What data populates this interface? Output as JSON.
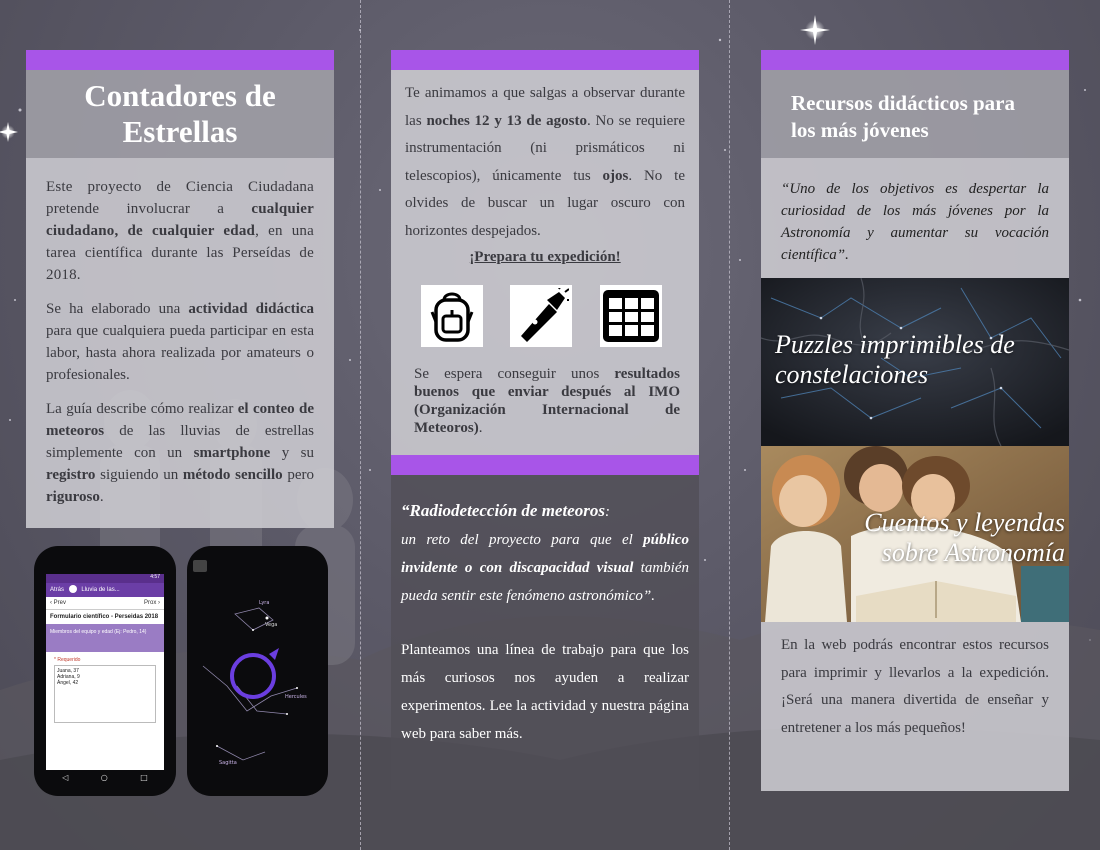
{
  "left": {
    "title": "Contadores de Estrellas",
    "p1": {
      "a": "Este proyecto de Ciencia Ciudadana pretende involucrar a ",
      "b": "cualquier ciudadano, de cualquier edad",
      "c": ", en una tarea científica durante las Perseídas de 2018."
    },
    "p2": {
      "a": "Se ha elaborado una ",
      "b": "actividad didáctica",
      "c": " para que cualquiera pueda participar en esta labor, hasta ahora realizada por amateurs o profesionales."
    },
    "p3": {
      "a": "La guía describe cómo realizar ",
      "b": "el conteo de meteoros",
      "c": " de las lluvias de estrellas simplemente con un ",
      "d": "smartphone",
      "e": " y su ",
      "f": "registro",
      "g": " siguiendo un ",
      "h": "método sencillo",
      "i": " pero ",
      "j": "riguroso",
      "k": "."
    },
    "phone1": {
      "status": "4:57",
      "back": "Atrás",
      "app_title": "Lluvia de las...",
      "prev": "Prev",
      "next": "Prox",
      "form_title": "Formulario científico - Perseidas 2018",
      "question": "Miembros del equipo y edad (Ej: Pedro, 14)",
      "required": "* Requerido",
      "answers": [
        "Juana, 37",
        "Adriana, 9",
        "Ángel, 42"
      ]
    },
    "phone2": {
      "labels": [
        "Lyra",
        "Vega",
        "Hercules",
        "Sagitta"
      ]
    }
  },
  "middle": {
    "p1": {
      "a": "Te animamos a que salgas a observar durante las ",
      "b": "noches 12 y 13 de agosto",
      "c": ". No se requiere instrumentación (ni prismáticos ni telescopios), únicamente tus ",
      "d": "ojos",
      "e": ". No te olvides de buscar un lugar oscuro con horizontes despejados."
    },
    "cta": "¡Prepara tu expedición!",
    "icons": [
      "backpack-icon",
      "flashlight-icon",
      "grid-sheet-icon"
    ],
    "p2": {
      "a": "Se espera conseguir unos ",
      "b": "resultados buenos que enviar después al IMO (Organización Internacional de Meteoros)",
      "c": "."
    },
    "radio": {
      "title": "“Radiodetección de meteoros",
      "colon": ":",
      "a": "un reto del proyecto para que el ",
      "b": "público invidente o con discapacidad visual",
      "c": " también pueda sentir este fenómeno astronómico”."
    },
    "p3": "Planteamos una línea de trabajo para que los más curiosos nos ayuden a realizar experimentos. Lee la actividad y nuestra página web para saber más."
  },
  "right": {
    "title": "Recursos didácticos para los más jóvenes",
    "quote": "“Uno de los objetivos es despertar la curiosidad de los más jóvenes por la Astronomía y aumentar su vocación científica”.",
    "puzzles": "Puzzles imprimibles de constelaciones",
    "stories": "Cuentos y leyendas sobre Astronomía",
    "footer": "En la web podrás encontrar estos recursos para imprimir y llevarlos a la expedición. ¡Será una manera divertida de enseñar y entretener a los más pequeños!"
  },
  "colors": {
    "accent": "#a855e8",
    "panel": "#cdccd2",
    "header": "#a09ea6"
  }
}
